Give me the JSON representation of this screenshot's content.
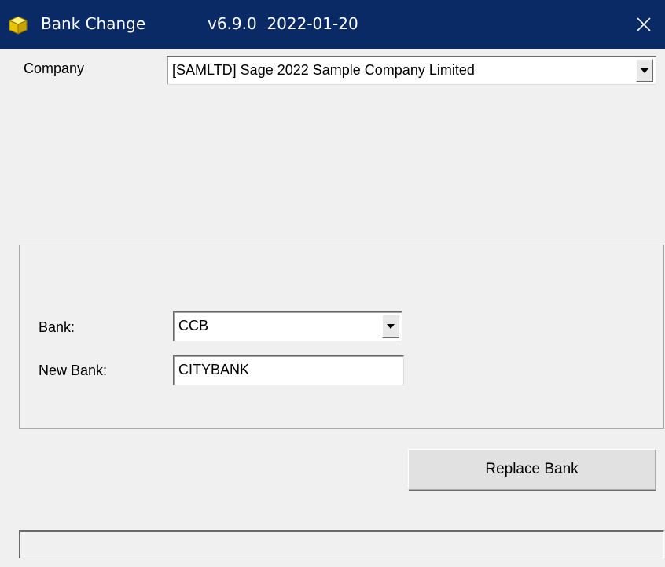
{
  "window": {
    "title": "Bank Change",
    "version": "v6.9.0  2022-01-20",
    "icon": "yellow-cube-icon",
    "close_glyph": "✕",
    "titlebar_color": "#0a2a66"
  },
  "company": {
    "label": "Company",
    "selected": "[SAMLTD] Sage 2022 Sample Company Limited"
  },
  "bank_group": {
    "bank_label": "Bank:",
    "bank_selected": "CCB",
    "new_bank_label": "New Bank:",
    "new_bank_value": "CITYBANK"
  },
  "actions": {
    "replace_label": "Replace Bank"
  },
  "status": {
    "text": ""
  }
}
